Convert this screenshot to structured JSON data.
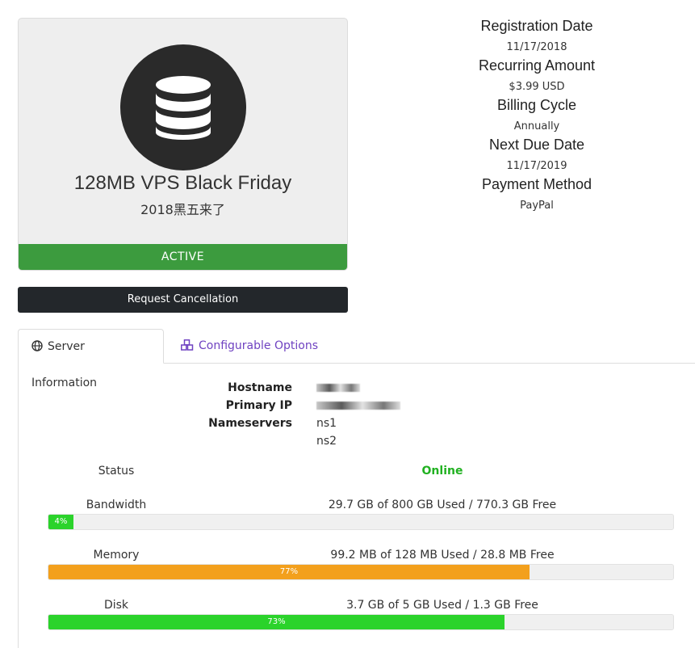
{
  "product": {
    "icon": "database-icon",
    "name": "128MB VPS Black Friday",
    "group": "2018黑五来了",
    "status": "ACTIVE",
    "cancel_label": "Request Cancellation"
  },
  "billing": [
    {
      "label": "Registration Date",
      "value": "11/17/2018"
    },
    {
      "label": "Recurring Amount",
      "value": "$3.99 USD"
    },
    {
      "label": "Billing Cycle",
      "value": "Annually"
    },
    {
      "label": "Next Due Date",
      "value": "11/17/2019"
    },
    {
      "label": "Payment Method",
      "value": "PayPal"
    }
  ],
  "tabs": [
    {
      "label": "Server Information",
      "icon": "globe-icon",
      "active": true
    },
    {
      "label": "Configurable Options",
      "icon": "cubes-icon",
      "active": false
    }
  ],
  "server": {
    "hostname_label": "Hostname",
    "primary_ip_label": "Primary IP",
    "nameservers_label": "Nameservers",
    "ns1": "ns1",
    "ns2": "ns2",
    "status_label": "Status",
    "status_value": "Online"
  },
  "usage": [
    {
      "label": "Bandwidth",
      "summary": "29.7 GB of 800 GB Used / 770.3 GB Free",
      "percent": 4,
      "percent_text": "4%",
      "color": "#2bd32b"
    },
    {
      "label": "Memory",
      "summary": "99.2 MB of 128 MB Used / 28.8 MB Free",
      "percent": 77,
      "percent_text": "77%",
      "color": "#f3a01c"
    },
    {
      "label": "Disk",
      "summary": "3.7 GB of 5 GB Used / 1.3 GB Free",
      "percent": 73,
      "percent_text": "73%",
      "color": "#2bd32b"
    }
  ],
  "colors": {
    "active_green": "#3c9b3e",
    "online_green": "#21b121",
    "tab_link": "#6f42c1",
    "button_dark": "#23272b"
  }
}
